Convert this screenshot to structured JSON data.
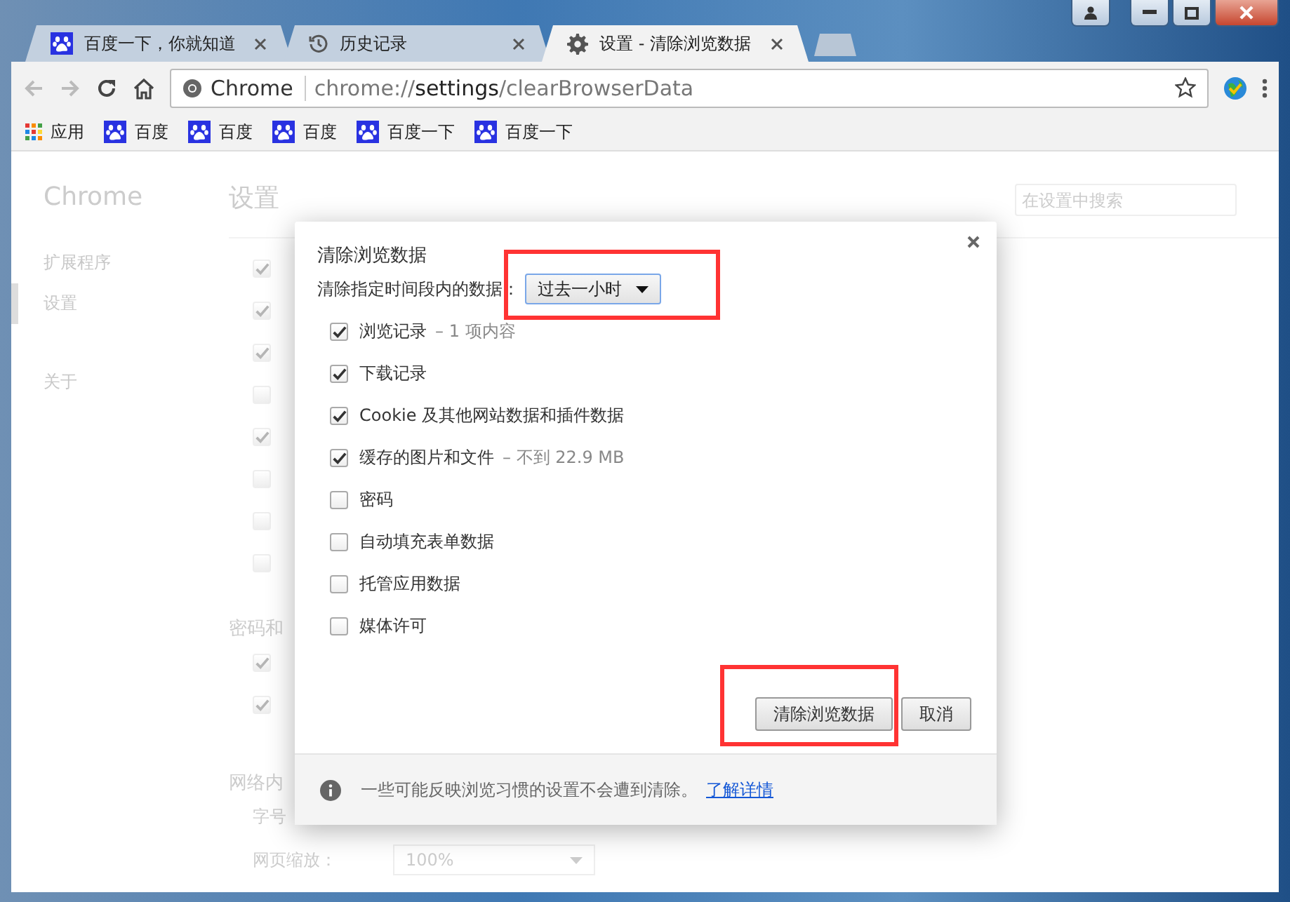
{
  "tabs": [
    {
      "title": "百度一下，你就知道",
      "selected": false
    },
    {
      "title": "历史记录",
      "selected": false
    },
    {
      "title": "设置 - 清除浏览数据",
      "selected": true
    }
  ],
  "omnibox": {
    "site": "Chrome",
    "scheme": "chrome://",
    "host": "settings",
    "path": "/clearBrowserData"
  },
  "bookmarks": [
    {
      "label": "应用",
      "kind": "apps"
    },
    {
      "label": "百度",
      "kind": "page"
    },
    {
      "label": "百度",
      "kind": "page"
    },
    {
      "label": "百度",
      "kind": "page"
    },
    {
      "label": "百度一下",
      "kind": "page"
    },
    {
      "label": "百度一下",
      "kind": "page"
    }
  ],
  "settings_page": {
    "sidebar": {
      "title": "Chrome",
      "items": [
        {
          "label": "扩展程序",
          "selected": false
        },
        {
          "label": "设置",
          "selected": true
        },
        {
          "label": "关于",
          "selected": false
        }
      ]
    },
    "heading": "设置",
    "search": {
      "placeholder": "在设置中搜索"
    },
    "privacy_options": [
      {
        "checked": true
      },
      {
        "checked": true
      },
      {
        "checked": true
      },
      {
        "checked": false
      },
      {
        "checked": true
      },
      {
        "checked": false
      },
      {
        "checked": false
      },
      {
        "checked": false
      }
    ],
    "passwords_heading": "密码和",
    "password_options": [
      {
        "checked": true
      },
      {
        "checked": true
      }
    ],
    "web_content_heading": "网络内",
    "font_size_label": "字号",
    "zoom_label": "网页缩放：",
    "zoom_value": "100%"
  },
  "dialog": {
    "title": "清除浏览数据",
    "range_label": "清除指定时间段内的数据：",
    "range_value": "过去一小时",
    "range_highlighted": true,
    "items": [
      {
        "label": "浏览记录",
        "detail": "–  1 项内容",
        "checked": true
      },
      {
        "label": "下载记录",
        "checked": true
      },
      {
        "label": "Cookie 及其他网站数据和插件数据",
        "checked": true
      },
      {
        "label": "缓存的图片和文件",
        "detail": "–  不到 22.9 MB",
        "checked": true
      },
      {
        "label": "密码",
        "checked": false
      },
      {
        "label": "自动填充表单数据",
        "checked": false
      },
      {
        "label": "托管应用数据",
        "checked": false
      },
      {
        "label": "媒体许可",
        "checked": false
      }
    ],
    "clear_button": "清除浏览数据",
    "clear_highlighted": true,
    "cancel_button": "取消",
    "footer_text": "一些可能反映浏览习惯的设置不会遭到清除。",
    "footer_link": "了解详情"
  }
}
